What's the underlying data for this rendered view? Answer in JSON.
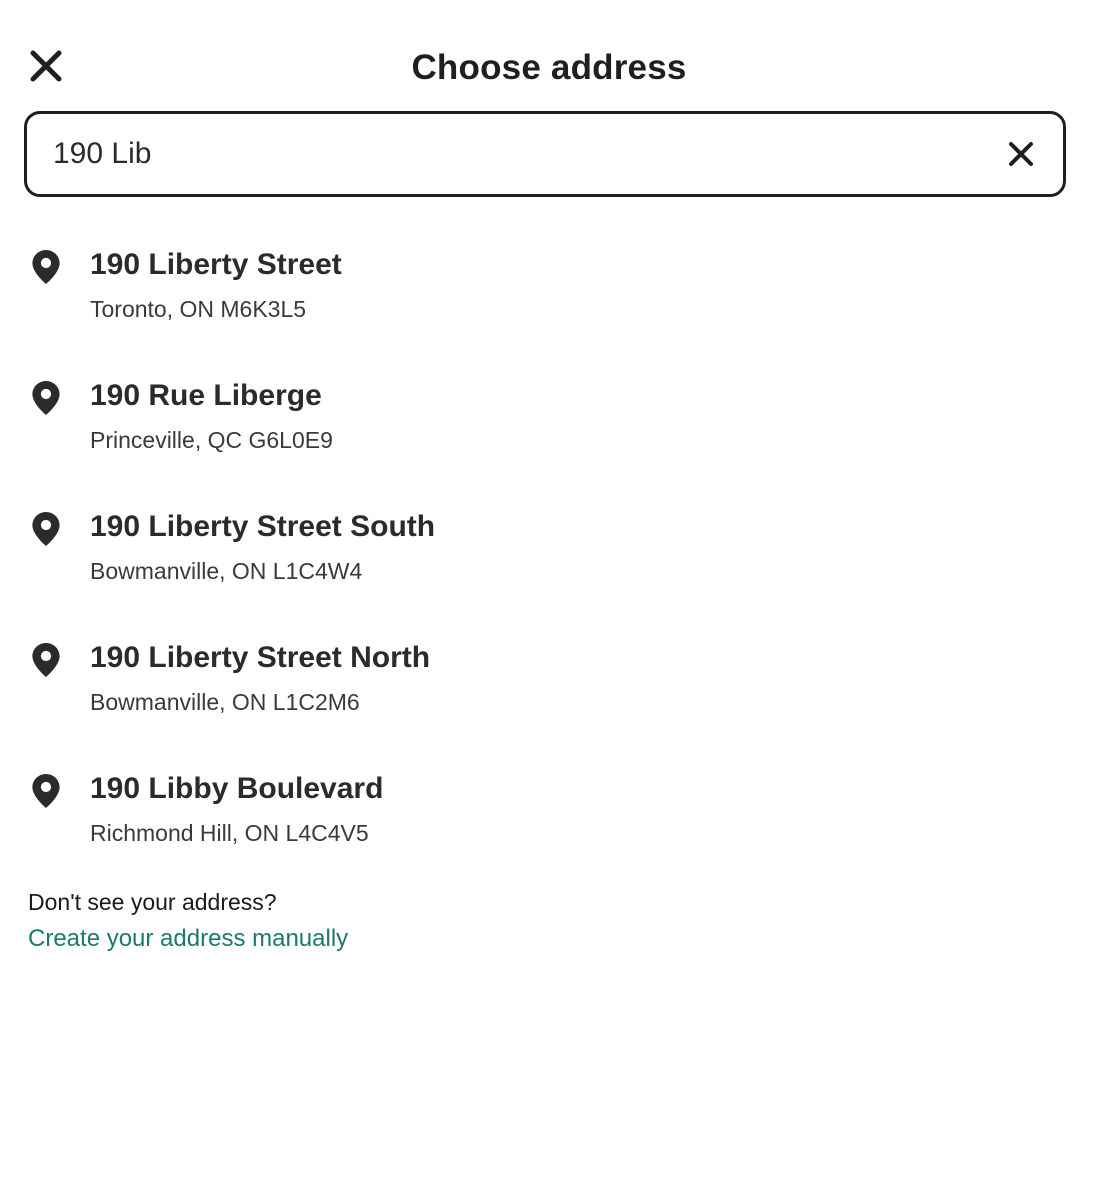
{
  "dialog": {
    "title": "Choose address"
  },
  "search": {
    "value": "190 Lib"
  },
  "results": [
    {
      "line1": "190 Liberty Street",
      "line2": "Toronto, ON M6K3L5"
    },
    {
      "line1": "190 Rue Liberge",
      "line2": "Princeville, QC G6L0E9"
    },
    {
      "line1": "190 Liberty Street South",
      "line2": "Bowmanville, ON L1C4W4"
    },
    {
      "line1": "190 Liberty Street North",
      "line2": "Bowmanville, ON L1C2M6"
    },
    {
      "line1": "190 Libby Boulevard",
      "line2": "Richmond Hill, ON L4C4V5"
    }
  ],
  "footer": {
    "question": "Don't see your address?",
    "link": "Create your address manually"
  },
  "icons": {
    "close": "close-icon",
    "clear": "clear-icon",
    "pin": "location-pin-icon"
  },
  "colors": {
    "link": "#1b7a6a",
    "text": "#2b2b2b",
    "border": "#1f1f1f"
  }
}
